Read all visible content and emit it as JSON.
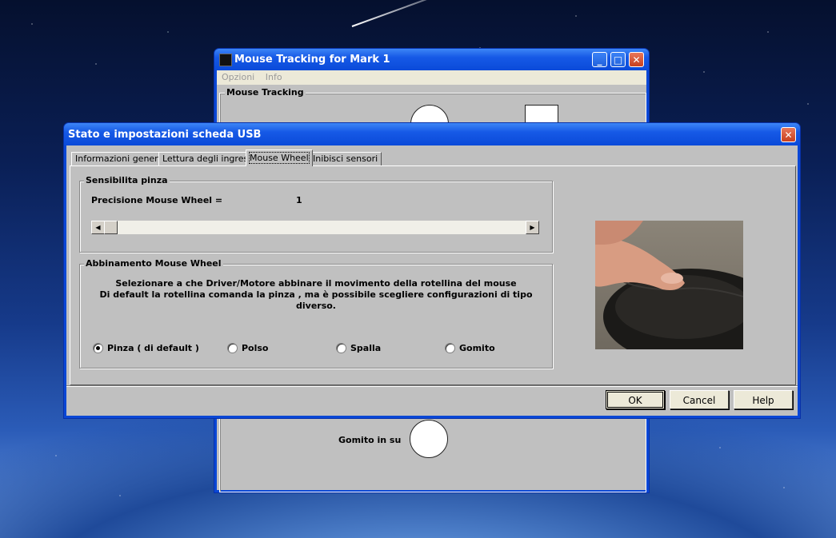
{
  "bg_window": {
    "title": "Mouse Tracking for Mark 1",
    "menu": [
      "Opzioni",
      "Info"
    ],
    "group_label": "Mouse Tracking",
    "label_bottom": "Gomito in su"
  },
  "dialog": {
    "title": "Stato e impostazioni scheda USB",
    "tabs": [
      {
        "label": "Informazioni generali"
      },
      {
        "label": "Lettura degli ingressi"
      },
      {
        "label": "Mouse Wheel"
      },
      {
        "label": "Inibisci sensori"
      }
    ],
    "active_tab": "Mouse Wheel",
    "sensitivity_group": {
      "label": "Sensibilita pinza",
      "precision_label": "Precisione Mouse Wheel =",
      "precision_value": "1",
      "slider_position": 0
    },
    "binding_group": {
      "label": "Abbinamento Mouse Wheel",
      "line1": "Selezionare a che Driver/Motore abbinare il movimento della rotellina del mouse",
      "line2": "Di default la rotellina comanda la pinza , ma è possibile scegliere configurazioni  di tipo diverso.",
      "options": [
        {
          "label": "Pinza ( di default )",
          "selected": true
        },
        {
          "label": "Polso",
          "selected": false
        },
        {
          "label": "Spalla",
          "selected": false
        },
        {
          "label": "Gomito",
          "selected": false
        }
      ]
    },
    "buttons": {
      "ok": "OK",
      "cancel": "Cancel",
      "help": "Help"
    }
  }
}
